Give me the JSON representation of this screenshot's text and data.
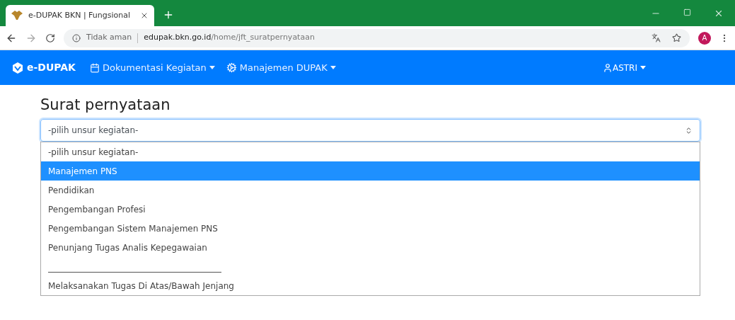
{
  "browser": {
    "tab_title": "e-DUPAK BKN | Fungsional",
    "security": "Tidak aman",
    "url_host": "edupak.bkn.go.id",
    "url_path": "/home/jft_suratpernyataan",
    "avatar": "A"
  },
  "navbar": {
    "brand": "e-DUPAK",
    "menus": [
      {
        "label": "Dokumentasi Kegiatan",
        "kind": "calendar"
      },
      {
        "label": "Manajemen DUPAK",
        "kind": "gears"
      }
    ],
    "user": "ASTRI"
  },
  "page": {
    "title": "Surat pernyataan",
    "select_value": "-pilih unsur kegiatan-",
    "options": [
      {
        "kind": "option",
        "label": "-pilih unsur kegiatan-",
        "selected": false
      },
      {
        "kind": "option",
        "label": "Manajemen PNS",
        "selected": true
      },
      {
        "kind": "option",
        "label": "Pendidikan",
        "selected": false
      },
      {
        "kind": "option",
        "label": "Pengembangan Profesi",
        "selected": false
      },
      {
        "kind": "option",
        "label": "Pengembangan Sistem Manajemen PNS",
        "selected": false
      },
      {
        "kind": "option",
        "label": "Penunjang Tugas Analis Kepegawaian",
        "selected": false
      },
      {
        "kind": "separator",
        "selected": false
      },
      {
        "kind": "option",
        "label": "Melaksanakan Tugas Di Atas/Bawah Jenjang",
        "selected": false
      }
    ]
  }
}
